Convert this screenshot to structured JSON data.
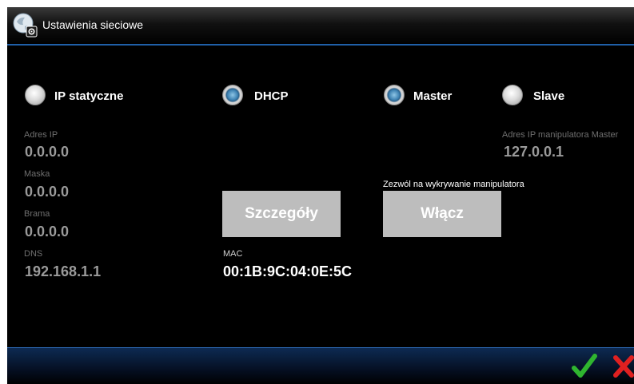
{
  "window": {
    "title": "Ustawienia sieciowe"
  },
  "mode": {
    "static": {
      "label": "IP statyczne",
      "selected": false
    },
    "dhcp": {
      "label": "DHCP",
      "selected": true
    }
  },
  "role": {
    "master": {
      "label": "Master",
      "selected": true
    },
    "slave": {
      "label": "Slave",
      "selected": false
    }
  },
  "network": {
    "ip_label": "Adres IP",
    "ip_value": "0.0.0.0",
    "mask_label": "Maska",
    "mask_value": "0.0.0.0",
    "gateway_label": "Brama",
    "gateway_value": "0.0.0.0",
    "dns_label": "DNS",
    "dns_value": "192.168.1.1",
    "master_ip_label": "Adres IP manipulatora Master",
    "master_ip_value": "127.0.0.1",
    "mac_label": "MAC",
    "mac_value": "00:1B:9C:04:0E:5C"
  },
  "buttons": {
    "details": "Szczegóły",
    "permit_label": "Zezwól na wykrywanie manipulatora",
    "enable": "Włącz"
  },
  "colors": {
    "accent_blue": "#3b7fb0",
    "confirm": "#2fb52f",
    "cancel": "#e02020"
  }
}
